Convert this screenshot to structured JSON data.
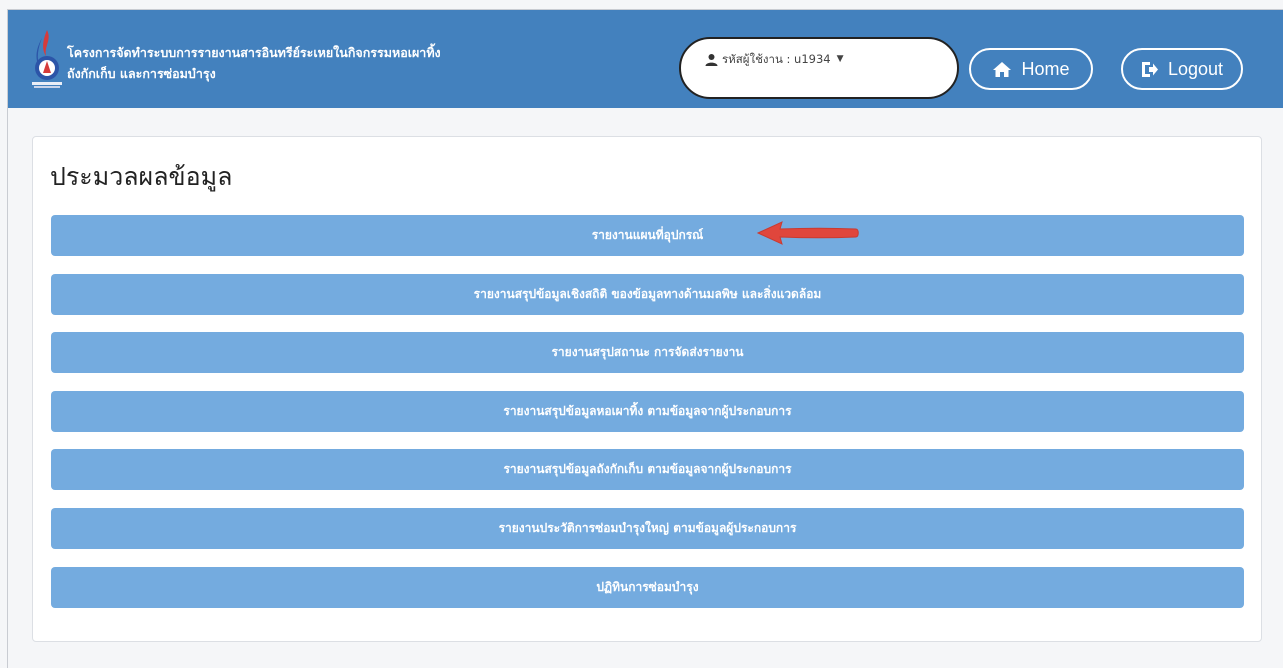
{
  "header": {
    "title_line1": "โครงการจัดทำระบบการรายงานสารอินทรีย์ระเหยในกิจกรรมหอเผาทิ้ง",
    "title_line2": "ถังกักเก็บ และการซ่อมบำรุง",
    "user_label": "รหัสผู้ใช้งาน : u1934",
    "home_label": "Home",
    "logout_label": "Logout"
  },
  "main": {
    "title": "ประมวลผลข้อมูล",
    "menu_items": [
      "รายงานแผนที่อุปกรณ์",
      "รายงานสรุปข้อมูลเชิงสถิติ ของข้อมูลทางด้านมลพิษ และสิ่งแวดล้อม",
      "รายงานสรุปสถานะ การจัดส่งรายงาน",
      "รายงานสรุปข้อมูลหอเผาทิ้ง ตามข้อมูลจากผู้ประกอบการ",
      "รายงานสรุปข้อมูลถังกักเก็บ ตามข้อมูลจากผู้ประกอบการ",
      "รายงานประวัติการซ่อมบำรุงใหญ่ ตามข้อมูลผู้ประกอบการ",
      "ปฏิทินการซ่อมบำรุง"
    ]
  },
  "icons": {
    "user": "user-icon",
    "home": "home-icon",
    "logout": "logout-icon",
    "caret": "caret-down-icon",
    "arrow": "red-arrow-annotation"
  },
  "colors": {
    "header_bg": "#4381be",
    "menu_button_bg": "#74abdf",
    "arrow": "#e0463c"
  }
}
